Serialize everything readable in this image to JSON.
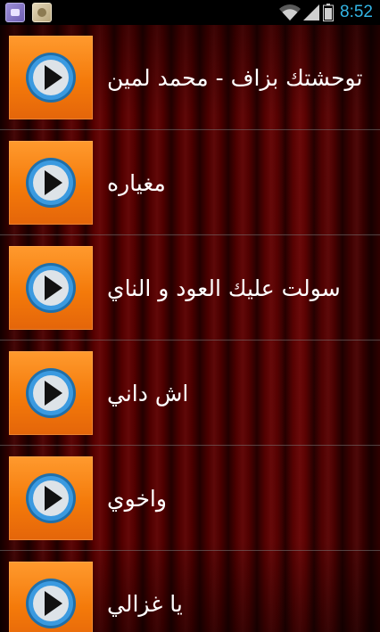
{
  "status_bar": {
    "time": "8:52",
    "clock_color": "#33b5e5",
    "icons": [
      "app-notification-icon",
      "photo-notification-icon",
      "wifi-icon",
      "signal-icon",
      "battery-icon"
    ]
  },
  "colors": {
    "thumb_orange": "#f47a0a",
    "play_ring": "#2e86c9",
    "curtain_red": "#560000"
  },
  "songs": [
    {
      "title": "توحشتك بزاف - محمد لمين",
      "icon": "play-icon"
    },
    {
      "title": "مغياره",
      "icon": "play-icon"
    },
    {
      "title": "سولت عليك العود و الناي",
      "icon": "play-icon"
    },
    {
      "title": "اش داني",
      "icon": "play-icon"
    },
    {
      "title": "واخوي",
      "icon": "play-icon"
    },
    {
      "title": "يا غزالي",
      "icon": "play-icon"
    }
  ]
}
